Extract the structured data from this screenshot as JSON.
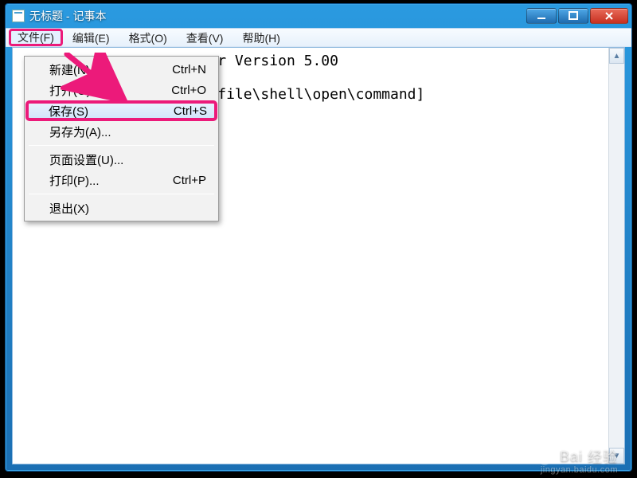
{
  "window": {
    "title": "无标题 - 记事本"
  },
  "menubar": {
    "items": [
      {
        "label": "文件(F)"
      },
      {
        "label": "编辑(E)"
      },
      {
        "label": "格式(O)"
      },
      {
        "label": "查看(V)"
      },
      {
        "label": "帮助(H)"
      }
    ]
  },
  "dropdown": {
    "items": [
      {
        "label": "新建(N)",
        "shortcut": "Ctrl+N"
      },
      {
        "label": "打开(O)...",
        "shortcut": "Ctrl+O"
      },
      {
        "label": "保存(S)",
        "shortcut": "Ctrl+S"
      },
      {
        "label": "另存为(A)...",
        "shortcut": ""
      },
      {
        "label": "页面设置(U)...",
        "shortcut": ""
      },
      {
        "label": "打印(P)...",
        "shortcut": "Ctrl+P"
      },
      {
        "label": "退出(X)",
        "shortcut": ""
      }
    ]
  },
  "content": {
    "line1_tail": "r Version 5.00",
    "line2_tail": "file\\shell\\open\\command]"
  },
  "watermark": {
    "brand": "Bai",
    "brand_suffix": "经验",
    "sub": "jingyan.baidu.com"
  },
  "colors": {
    "annotation_pink": "#ec1a7a"
  }
}
